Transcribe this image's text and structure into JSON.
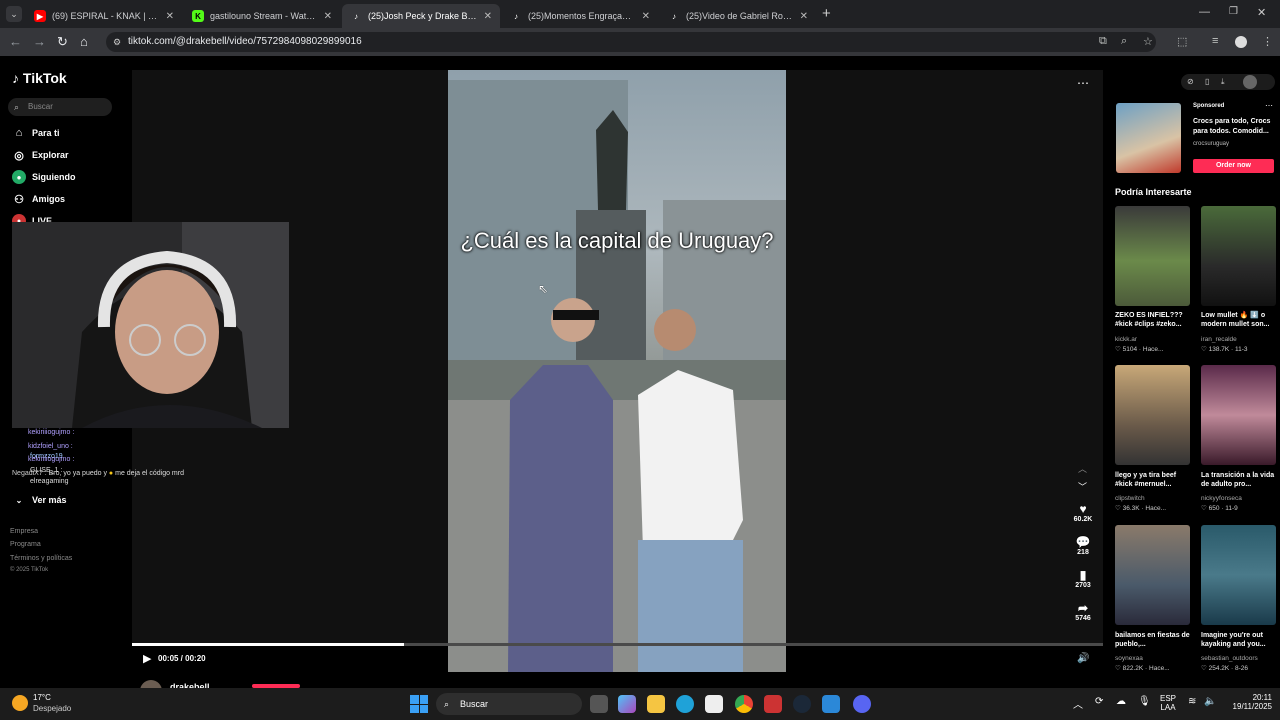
{
  "browser": {
    "tabs": [
      {
        "title": "(69) ESPIRAL - KNAK | #POSITIV",
        "active": false
      },
      {
        "title": "gastilouno Stream - Watch Live",
        "active": false
      },
      {
        "title": "(25)Josh Peck y Drake Bell: Con",
        "active": true
      },
      {
        "title": "(25)Momentos Engraçados com",
        "active": false
      },
      {
        "title": "(25)Video de Gabriel Romero (@",
        "active": false
      }
    ],
    "new_tab": "+",
    "url": "tiktok.com/@drakebell/video/7572984098029899016"
  },
  "sidebar": {
    "logo": "TikTok",
    "search_placeholder": "Buscar",
    "nav": [
      {
        "label": "Para ti",
        "icon": "home-icon"
      },
      {
        "label": "Explorar",
        "icon": "compass-icon"
      },
      {
        "label": "Siguiendo",
        "icon": "following-icon"
      },
      {
        "label": "Amigos",
        "icon": "friends-icon"
      },
      {
        "label": "LIVE",
        "icon": "live-icon"
      }
    ],
    "see_more": "Ver más",
    "footer": [
      "Empresa",
      "Programa",
      "Términos y políticas",
      "© 2025 TikTok"
    ]
  },
  "chat": {
    "lines": [
      "kekiriiiogujmo :",
      "kidzfoiel_uno :",
      "formzzo19",
      "kekiriiiogujmo :",
      "GLISE_1 :",
      "elreagaming"
    ],
    "message_user": "NegadiX7 :",
    "message_text": "Bro, yo ya puedo y",
    "message_text2": "me deja el código mrd"
  },
  "video": {
    "caption": "¿Cuál es la capital de Uruguay?",
    "current_time": "00:05",
    "duration": "00:20",
    "time_display": "00:05 / 00:20",
    "progress": 0.28,
    "author": "drakebell"
  },
  "actions": {
    "likes": "60.2K",
    "comments": "218",
    "saves": "2703",
    "shares": "5746"
  },
  "ad": {
    "label": "Sponsored",
    "text": "Crocs para todo, Crocs para todos. Comodid...",
    "advertiser": "crocsuruguay",
    "cta": "Order now"
  },
  "recommended": {
    "heading": "Podría Interesarte",
    "items": [
      {
        "title": "ZEKO ES INFIEL??? #kick #clips #zeko...",
        "author": "kickk.ar",
        "stats": "5104 · Hace..."
      },
      {
        "title": "Low mullet 🔥 ⬇️ o modern mullet son...",
        "author": "iran_recalde",
        "stats": "138.7K · 11-3"
      },
      {
        "title": "llego y ya tira beef #kick #mernuel...",
        "author": "clipstwitch",
        "stats": "36.3K · Hace..."
      },
      {
        "title": "La transición a la vida de adulto pro...",
        "author": "nickyyfonseca",
        "stats": "650 · 11-9"
      },
      {
        "title": "bailamos en fiestas de pueblo,...",
        "author": "soynexaa",
        "stats": "822.2K · Hace..."
      },
      {
        "title": "Imagine you're out kayaking and you...",
        "author": "sebastian_outdoors",
        "stats": "254.2K · 8-26"
      }
    ]
  },
  "taskbar": {
    "weather_temp": "17°C",
    "weather_desc": "Despejado",
    "search_label": "Buscar",
    "lang1": "ESP",
    "lang2": "LAA",
    "time": "20:11",
    "date": "19/11/2025"
  }
}
